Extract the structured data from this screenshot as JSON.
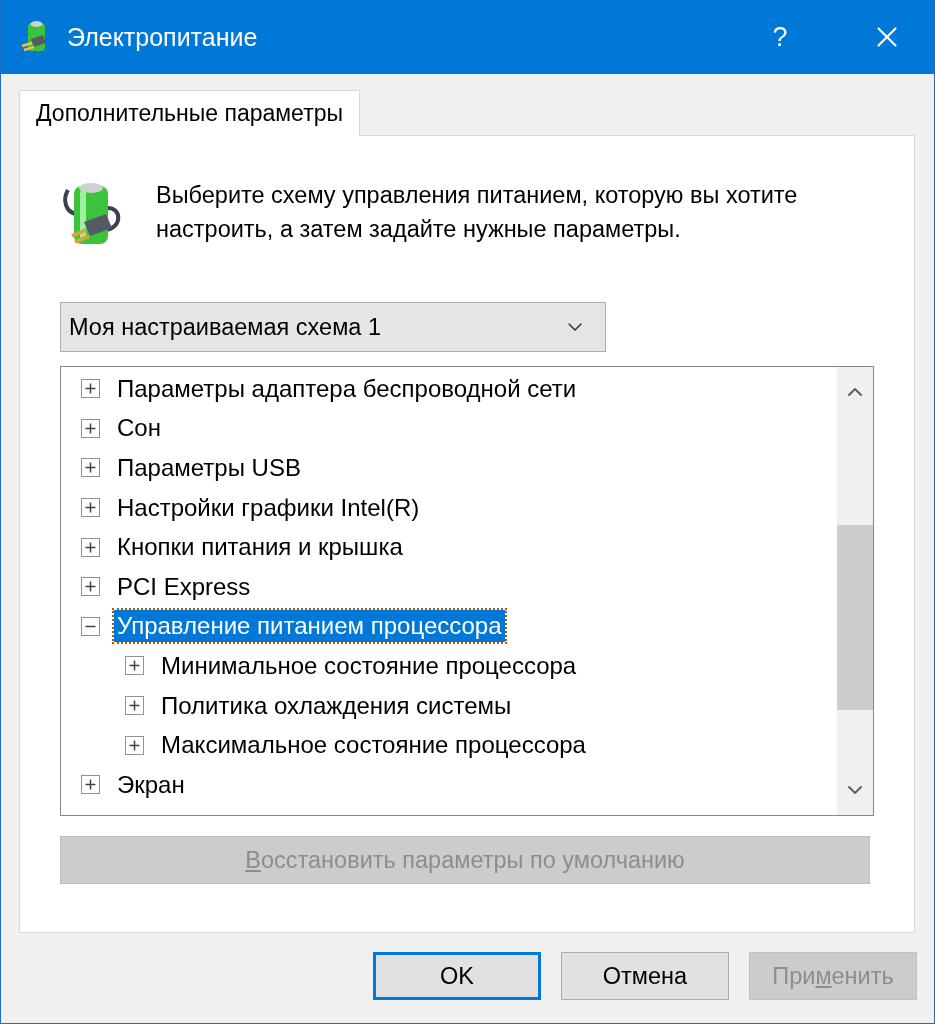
{
  "window": {
    "title": "Электропитание",
    "help": "?"
  },
  "tabs": [
    {
      "label": "Дополнительные параметры",
      "selected": true
    }
  ],
  "description": "Выберите схему управления питанием, которую вы хотите настроить, а затем задайте нужные параметры.",
  "scheme_dropdown": {
    "value": "Моя настраиваемая схема 1"
  },
  "settings_tree": [
    {
      "label": "Параметры адаптера беспроводной сети",
      "expanded": false,
      "selected": false
    },
    {
      "label": "Сон",
      "expanded": false,
      "selected": false
    },
    {
      "label": "Параметры USB",
      "expanded": false,
      "selected": false
    },
    {
      "label": "Настройки графики Intel(R)",
      "expanded": false,
      "selected": false
    },
    {
      "label": "Кнопки питания и крышка",
      "expanded": false,
      "selected": false
    },
    {
      "label": "PCI Express",
      "expanded": false,
      "selected": false
    },
    {
      "label": "Управление питанием процессора",
      "expanded": true,
      "selected": true,
      "children": [
        {
          "label": "Минимальное состояние процессора",
          "expanded": false,
          "selected": false
        },
        {
          "label": "Политика охлаждения системы",
          "expanded": false,
          "selected": false
        },
        {
          "label": "Максимальное состояние процессора",
          "expanded": false,
          "selected": false
        }
      ]
    },
    {
      "label": "Экран",
      "expanded": false,
      "selected": false
    }
  ],
  "restore_button": {
    "disabled": true,
    "parts": [
      {
        "text": "В",
        "underlined": true
      },
      {
        "text": "осстановить параметры по умолчанию",
        "underlined": false
      }
    ]
  },
  "buttons": [
    {
      "parts": [
        {
          "text": "OK",
          "underlined": false
        }
      ],
      "default": true,
      "disabled": false
    },
    {
      "parts": [
        {
          "text": "Отмена",
          "underlined": false
        }
      ],
      "default": false,
      "disabled": false
    },
    {
      "parts": [
        {
          "text": "При",
          "underlined": false
        },
        {
          "text": "м",
          "underlined": true
        },
        {
          "text": "енить",
          "underlined": false
        }
      ],
      "default": false,
      "disabled": true
    }
  ]
}
